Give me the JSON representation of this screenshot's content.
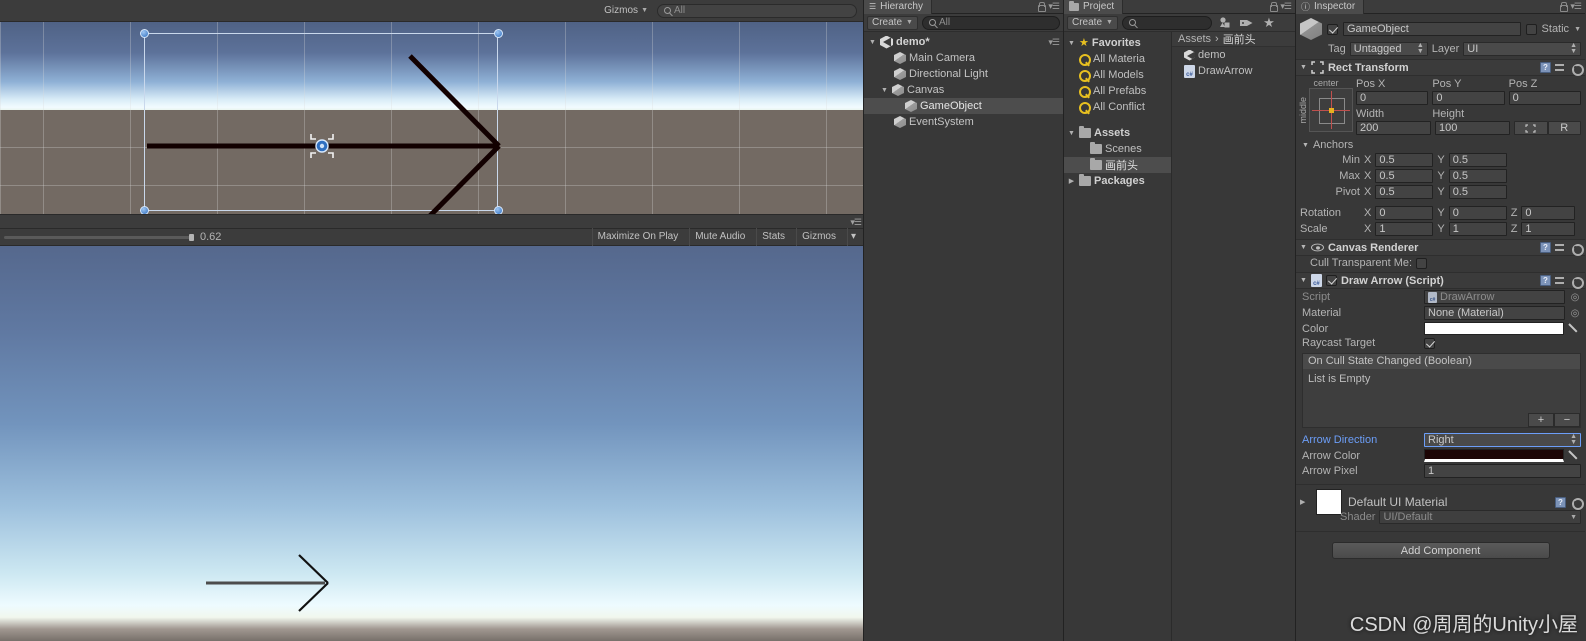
{
  "scene_view": {
    "toolbar": {
      "gizmos_label": "Gizmos",
      "search_placeholder": "All",
      "search_value": ""
    },
    "selection": {
      "handle_count": 4
    }
  },
  "game_view": {
    "scale_value": "0.62",
    "maximize_on_play": "Maximize On Play",
    "mute_audio": "Mute Audio",
    "stats": "Stats",
    "gizmos": "Gizmos"
  },
  "hierarchy": {
    "tab_label": "Hierarchy",
    "create_label": "Create",
    "search_placeholder": "All",
    "scene_name": "demo*",
    "items": [
      {
        "label": "Main Camera",
        "indent": 1,
        "icon": "cube-icon",
        "expandable": false,
        "selected": false
      },
      {
        "label": "Directional Light",
        "indent": 1,
        "icon": "cube-icon",
        "expandable": false,
        "selected": false
      },
      {
        "label": "Canvas",
        "indent": 1,
        "icon": "cube-icon",
        "expandable": true,
        "selected": false
      },
      {
        "label": "GameObject",
        "indent": 2,
        "icon": "cube-icon",
        "expandable": false,
        "selected": true
      },
      {
        "label": "EventSystem",
        "indent": 1,
        "icon": "cube-icon",
        "expandable": false,
        "selected": false
      }
    ]
  },
  "project": {
    "tab_label": "Project",
    "create_label": "Create",
    "search_value": "",
    "breadcrumb": {
      "root": "Assets",
      "separator": "›",
      "current": "画前头"
    },
    "tree": [
      {
        "label": "Favorites",
        "indent": 0,
        "icon": "star-icon",
        "expandable": true,
        "bold": true,
        "selected": false
      },
      {
        "label": "All Materia",
        "indent": 1,
        "icon": "search-icon",
        "expandable": false,
        "bold": false,
        "selected": false
      },
      {
        "label": "All Models",
        "indent": 1,
        "icon": "search-icon",
        "expandable": false,
        "bold": false,
        "selected": false
      },
      {
        "label": "All Prefabs",
        "indent": 1,
        "icon": "search-icon",
        "expandable": false,
        "bold": false,
        "selected": false
      },
      {
        "label": "All Conflict",
        "indent": 1,
        "icon": "search-icon",
        "expandable": false,
        "bold": false,
        "selected": false
      },
      {
        "label": "Assets",
        "indent": 0,
        "icon": "folder-icon",
        "expandable": true,
        "bold": true,
        "selected": false
      },
      {
        "label": "Scenes",
        "indent": 1,
        "icon": "folder-icon",
        "expandable": false,
        "bold": false,
        "selected": false
      },
      {
        "label": "画前头",
        "indent": 1,
        "icon": "folder-icon",
        "expandable": false,
        "bold": false,
        "selected": true
      },
      {
        "label": "Packages",
        "indent": 0,
        "icon": "folder-icon",
        "expandable": true,
        "bold": true,
        "selected": false
      }
    ],
    "contents": [
      {
        "label": "demo",
        "icon": "unity-scene-icon"
      },
      {
        "label": "DrawArrow",
        "icon": "csharp-script-icon"
      }
    ]
  },
  "inspector": {
    "tab_label": "Inspector",
    "object_name": "GameObject",
    "object_enabled": true,
    "static_label": "Static",
    "static_checked": false,
    "tag_label": "Tag",
    "tag_value": "Untagged",
    "layer_label": "Layer",
    "layer_value": "UI",
    "rect_transform": {
      "title": "Rect Transform",
      "anchor_preset_h": "center",
      "anchor_preset_v": "middle",
      "pos_x_label": "Pos X",
      "pos_x": "0",
      "pos_y_label": "Pos Y",
      "pos_y": "0",
      "pos_z_label": "Pos Z",
      "pos_z": "0",
      "width_label": "Width",
      "width": "200",
      "height_label": "Height",
      "height": "100",
      "blueprint_label": "",
      "raw_label": "R",
      "anchors_label": "Anchors",
      "min_label": "Min",
      "min_x": "0.5",
      "min_y": "0.5",
      "max_label": "Max",
      "max_x": "0.5",
      "max_y": "0.5",
      "pivot_label": "Pivot",
      "pivot_x": "0.5",
      "pivot_y": "0.5",
      "rotation_label": "Rotation",
      "rot_x": "0",
      "rot_y": "0",
      "rot_z": "0",
      "scale_label": "Scale",
      "scale_x": "1",
      "scale_y": "1",
      "scale_z": "1",
      "axis_x": "X",
      "axis_y": "Y",
      "axis_z": "Z"
    },
    "canvas_renderer": {
      "title": "Canvas Renderer",
      "cull_label": "Cull Transparent Me:",
      "cull_checked": false
    },
    "draw_arrow": {
      "title": "Draw Arrow (Script)",
      "enabled": true,
      "script_label": "Script",
      "script_value": "DrawArrow",
      "material_label": "Material",
      "material_value": "None (Material)",
      "color_label": "Color",
      "color_value": "#FFFFFF",
      "raycast_label": "Raycast Target",
      "raycast_checked": true,
      "event_header": "On Cull State Changed (Boolean)",
      "event_empty": "List is Empty",
      "add_btn": "+",
      "remove_btn": "−",
      "arrow_direction_label": "Arrow Direction",
      "arrow_direction_value": "Right",
      "arrow_color_label": "Arrow Color",
      "arrow_color_value": "#1C0505",
      "arrow_pixel_label": "Arrow Pixel",
      "arrow_pixel_value": "1"
    },
    "material": {
      "title": "Default UI Material",
      "shader_label": "Shader",
      "shader_value": "UI/Default"
    },
    "add_component": "Add Component"
  },
  "watermark": "CSDN @周周的Unity小屋",
  "colors": {
    "panel_bg": "#383838",
    "tab_bg": "#4b4b4b",
    "selection": "#4d4d4d",
    "accent_blue": "#6c9ef8",
    "favorite_yellow": "#e8c020"
  }
}
